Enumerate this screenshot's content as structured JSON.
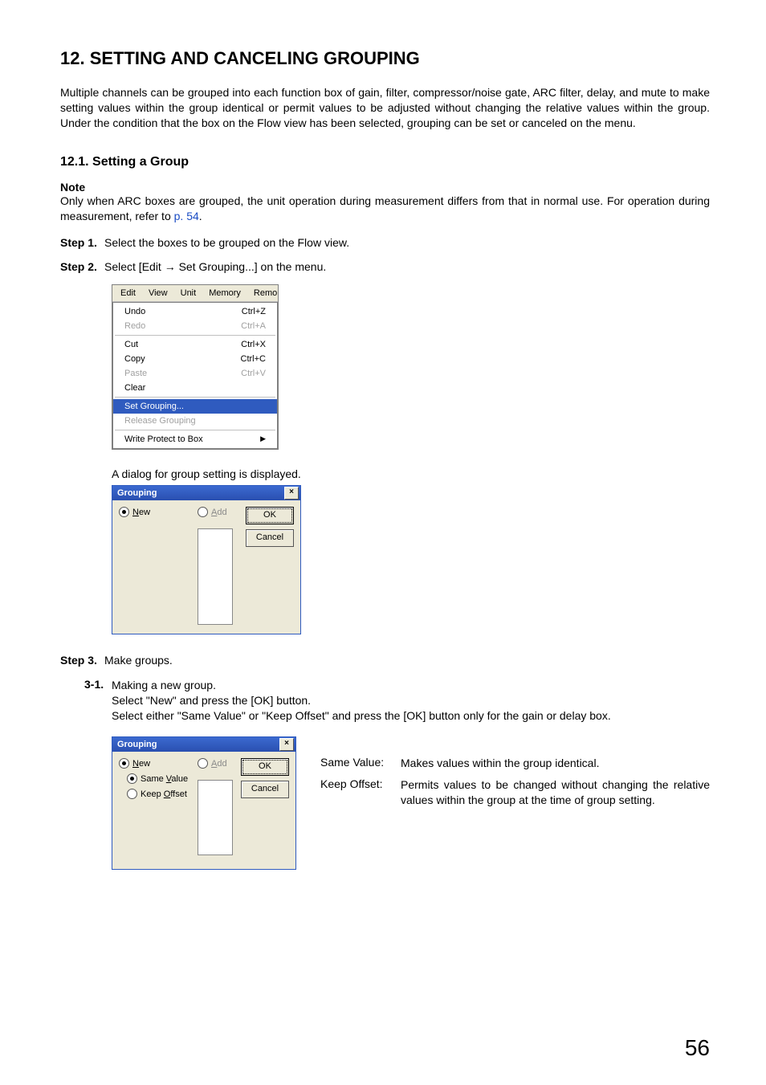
{
  "heading": "12. SETTING AND CANCELING GROUPING",
  "intro": "Multiple channels can be grouped into each function box of gain, filter, compressor/noise gate, ARC filter, delay, and mute to make setting values within the group identical or permit values to be adjusted without changing the relative values within the group. Under the condition that the box on the Flow view has been selected, grouping can be set or canceled on the menu.",
  "sub_heading": "12.1. Setting a Group",
  "note_label": "Note",
  "note_body_1": "Only when ARC boxes are grouped, the unit operation during measurement differs from that in normal use. For operation during measurement, refer to ",
  "note_link": "p. 54",
  "note_body_2": ".",
  "steps": {
    "s1_label": "Step 1.",
    "s1_text": "Select the boxes to be grouped on the Flow view.",
    "s2_label": "Step 2.",
    "s2_text_pre": "Select [Edit ",
    "s2_text_post": " Set Grouping...] on the menu.",
    "dialog_intro": "A dialog for group setting is displayed.",
    "s3_label": "Step 3.",
    "s3_text": "Make groups.",
    "s31_label": "3-1.",
    "s31_l1": "Making a new group.",
    "s31_l2": "Select \"New\" and press the [OK] button.",
    "s31_l3": "Select either \"Same Value\" or \"Keep Offset\" and press the [OK] button only for the gain or delay box."
  },
  "menubar": {
    "edit": "Edit",
    "view": "View",
    "unit": "Unit",
    "memory": "Memory",
    "remote": "Remo"
  },
  "menu": {
    "undo": "Undo",
    "undo_sc": "Ctrl+Z",
    "redo": "Redo",
    "redo_sc": "Ctrl+A",
    "cut": "Cut",
    "cut_sc": "Ctrl+X",
    "copy": "Copy",
    "copy_sc": "Ctrl+C",
    "paste": "Paste",
    "paste_sc": "Ctrl+V",
    "clear": "Clear",
    "set_grouping": "Set Grouping...",
    "release_grouping": "Release Grouping",
    "write_protect": "Write Protect to Box"
  },
  "dialog": {
    "title": "Grouping",
    "close": "×",
    "new_u": "N",
    "new_rest": "ew",
    "add_u": "A",
    "add_rest": "dd",
    "same_pre": "Same ",
    "same_u": "V",
    "same_post": "alue",
    "keep_pre": "Keep ",
    "keep_u": "O",
    "keep_post": "ffset",
    "ok": "OK",
    "cancel": "Cancel"
  },
  "defs": {
    "same_term": "Same Value:",
    "same_val": "Makes values within the group identical.",
    "keep_term": "Keep Offset:",
    "keep_val": "Permits values to be changed without changing the relative values within the group at the time of group setting."
  },
  "page_number": "56"
}
